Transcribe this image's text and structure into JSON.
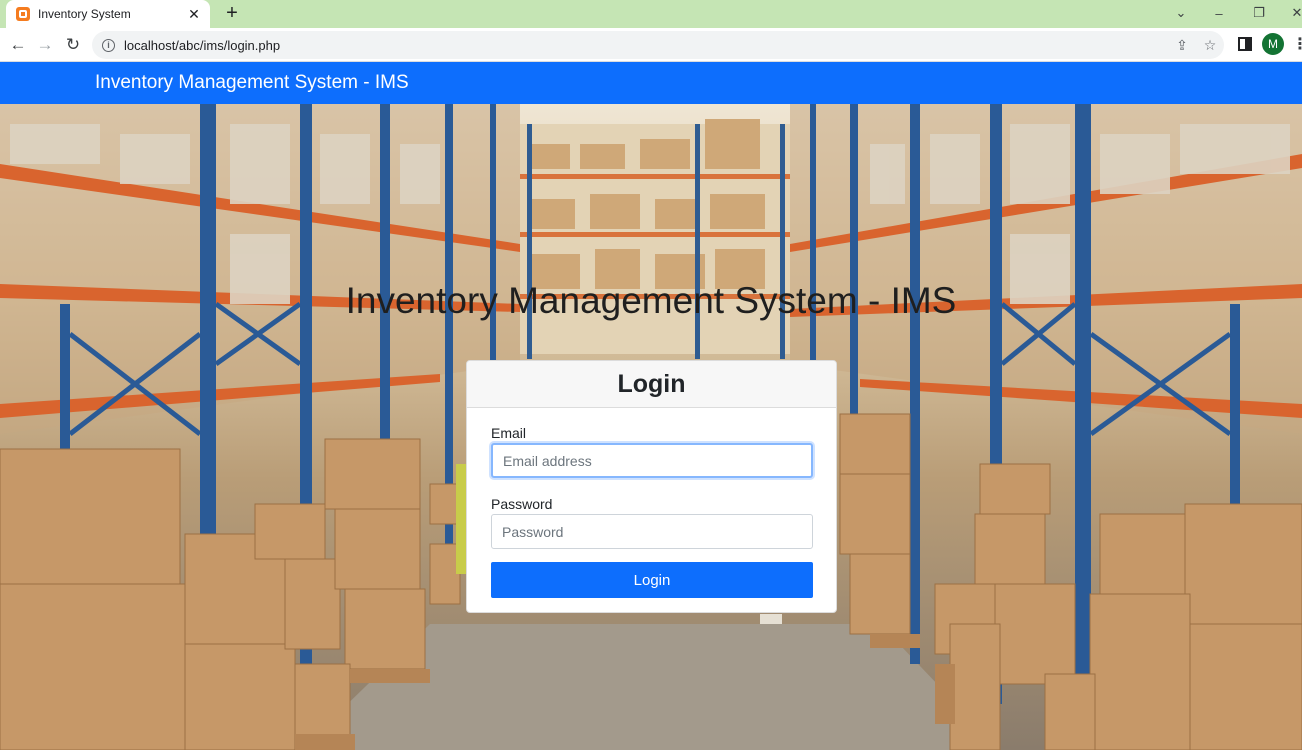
{
  "browser": {
    "tab_title": "Inventory System",
    "url": "localhost/abc/ims/login.php",
    "profile_initial": "M"
  },
  "navbar": {
    "brand": "Inventory Management System - IMS"
  },
  "hero": {
    "title": "Inventory Management System - IMS"
  },
  "login_card": {
    "header": "Login",
    "email_label": "Email",
    "email_placeholder": "Email address",
    "password_label": "Password",
    "password_placeholder": "Password",
    "submit_label": "Login"
  },
  "colors": {
    "navbar": "#0d6efd",
    "button": "#0d6efd",
    "tabstrip": "#c5e5b4"
  },
  "icons": {
    "favicon": "xampp-icon",
    "back": "arrow-left-icon",
    "forward": "arrow-right-icon",
    "reload": "reload-icon",
    "site_info": "info-icon",
    "share": "share-icon",
    "bookmark": "star-icon",
    "side_panel": "side-panel-icon",
    "menu": "kebab-menu-icon"
  }
}
